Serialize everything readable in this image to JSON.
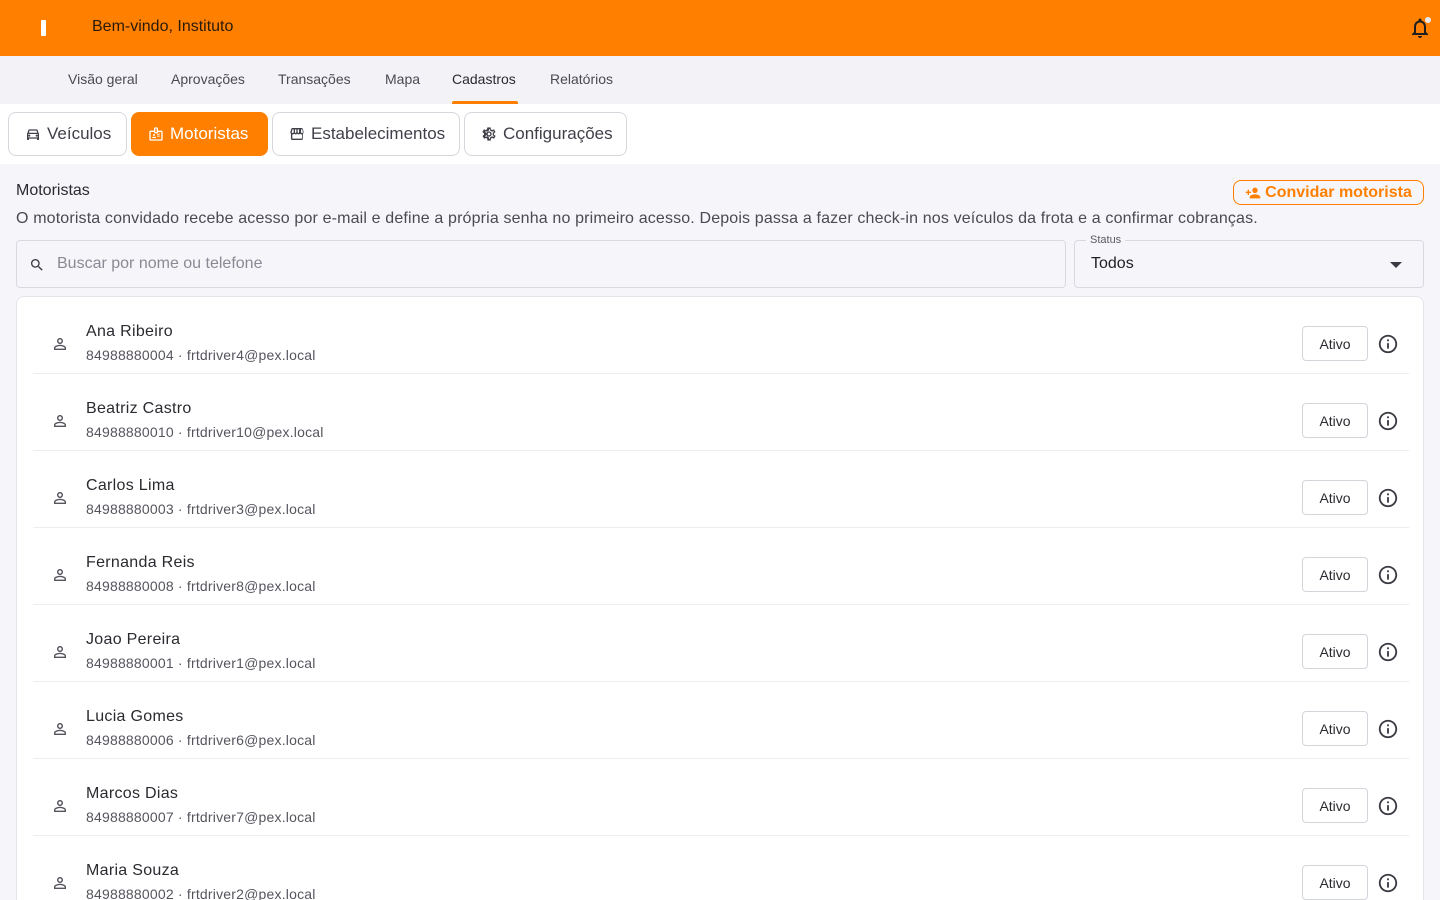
{
  "header": {
    "logo_letter": "I",
    "welcome": "Bem-vindo, Instituto",
    "notification_icon": "bell-icon"
  },
  "nav": {
    "items": [
      "Visão geral",
      "Aprovações",
      "Transações",
      "Mapa",
      "Cadastros",
      "Relatórios"
    ],
    "active": "Cadastros"
  },
  "subtabs": {
    "items": [
      {
        "label": "Veículos",
        "icon": "car-icon"
      },
      {
        "label": "Motoristas",
        "icon": "driver-badge-icon"
      },
      {
        "label": "Estabelecimentos",
        "icon": "store-icon"
      },
      {
        "label": "Configurações",
        "icon": "gear-icon"
      }
    ],
    "active": "Motoristas"
  },
  "section": {
    "title": "Motoristas",
    "description": "O motorista convidado recebe acesso por e-mail e define a própria senha no primeiro acesso. Depois passa a fazer check-in nos veículos da frota e a confirmar cobranças.",
    "invite_label": "Convidar motorista"
  },
  "search": {
    "placeholder": "Buscar por nome ou telefone",
    "value": ""
  },
  "status_filter": {
    "label": "Status",
    "value": "Todos"
  },
  "drivers": [
    {
      "name": "Ana Ribeiro",
      "sub": "84988880004 · frtdriver4@pex.local",
      "status": "Ativo"
    },
    {
      "name": "Beatriz Castro",
      "sub": "84988880010 · frtdriver10@pex.local",
      "status": "Ativo"
    },
    {
      "name": "Carlos Lima",
      "sub": "84988880003 · frtdriver3@pex.local",
      "status": "Ativo"
    },
    {
      "name": "Fernanda Reis",
      "sub": "84988880008 · frtdriver8@pex.local",
      "status": "Ativo"
    },
    {
      "name": "Joao Pereira",
      "sub": "84988880001 · frtdriver1@pex.local",
      "status": "Ativo"
    },
    {
      "name": "Lucia Gomes",
      "sub": "84988880006 · frtdriver6@pex.local",
      "status": "Ativo"
    },
    {
      "name": "Marcos Dias",
      "sub": "84988880007 · frtdriver7@pex.local",
      "status": "Ativo"
    },
    {
      "name": "Maria Souza",
      "sub": "84988880002 · frtdriver2@pex.local",
      "status": "Ativo"
    }
  ],
  "colors": {
    "accent": "#ff8000",
    "background": "#f6f5f9"
  }
}
